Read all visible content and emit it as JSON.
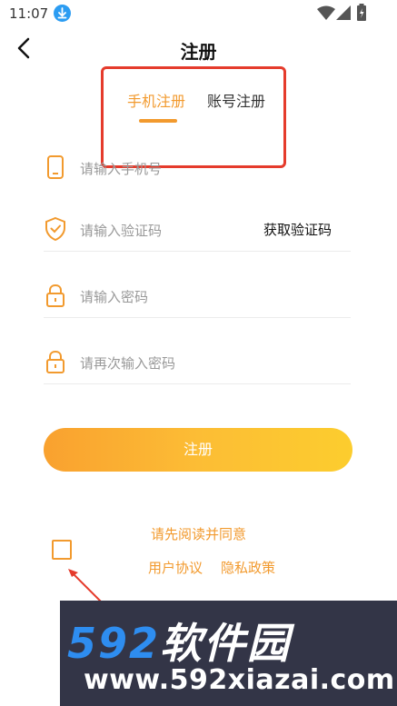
{
  "status": {
    "time": "11:07"
  },
  "header": {
    "title": "注册"
  },
  "tabs": [
    {
      "label": "手机注册",
      "active": true
    },
    {
      "label": "账号注册",
      "active": false
    }
  ],
  "fields": {
    "phone": {
      "placeholder": "请输入手机号"
    },
    "code": {
      "placeholder": "请输入验证码",
      "action": "获取验证码"
    },
    "password": {
      "placeholder": "请输入密码"
    },
    "password_confirm": {
      "placeholder": "请再次输入密码"
    }
  },
  "submit": {
    "label": "注册"
  },
  "agreement": {
    "text": "请先阅读并同意",
    "user_agreement": "用户协议",
    "privacy_policy": "隐私政策"
  },
  "watermark": {
    "number": "592",
    "brand": "软件园",
    "url": "www.592xiazai.com"
  },
  "colors": {
    "accent": "#f29a2e",
    "annotation": "#e53b2c",
    "download_icon": "#2b9cf2"
  },
  "icons": [
    "download-icon",
    "wifi-icon",
    "signal-icon",
    "battery-icon",
    "back-arrow-icon",
    "phone-icon",
    "shield-check-icon",
    "lock-icon"
  ]
}
